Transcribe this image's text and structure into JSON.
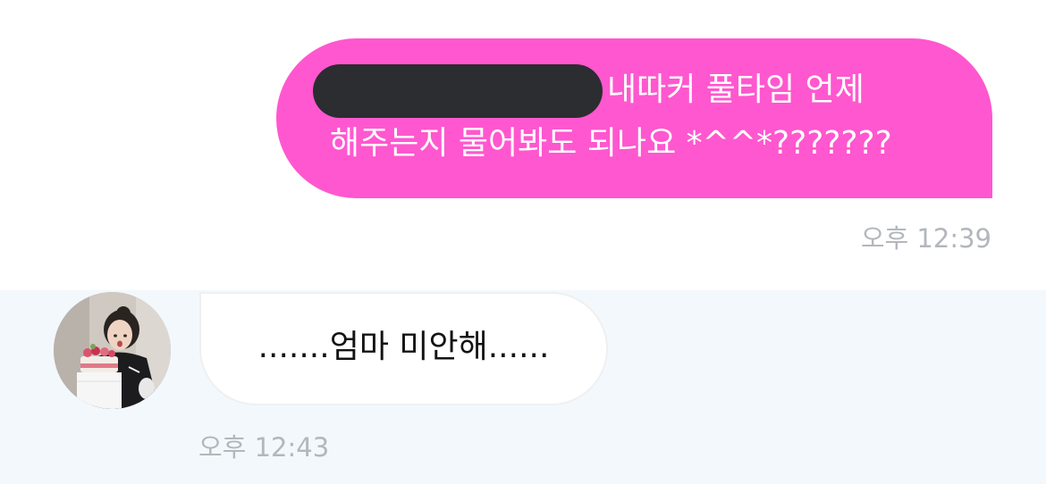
{
  "sent_message": {
    "line1": "내따커 풀타임 언제",
    "line2": "해주는지 물어봐도 되나요 *^^*???????",
    "time": "오후 12:39",
    "bubble_color": "#ff57cf",
    "redacted": true
  },
  "received_message": {
    "text": ".......엄마 미안해......",
    "time": "오후 12:43",
    "avatar_icon": "profile-photo"
  },
  "colors": {
    "sent_bg": "#ffffff",
    "received_bg": "#f3f8fc",
    "timestamp": "#b3b7bc",
    "redaction": "#2b2d30"
  }
}
